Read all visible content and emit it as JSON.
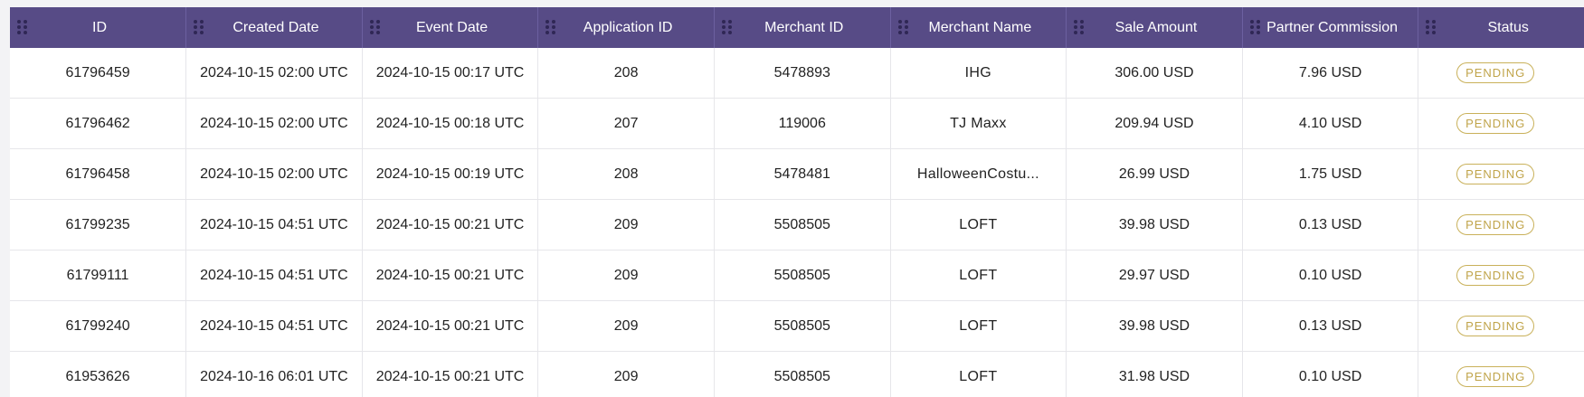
{
  "table": {
    "columns": [
      {
        "key": "id",
        "label": "ID"
      },
      {
        "key": "created_date",
        "label": "Created Date"
      },
      {
        "key": "event_date",
        "label": "Event Date"
      },
      {
        "key": "application_id",
        "label": "Application ID"
      },
      {
        "key": "merchant_id",
        "label": "Merchant ID"
      },
      {
        "key": "merchant_name",
        "label": "Merchant Name"
      },
      {
        "key": "sale_amount",
        "label": "Sale Amount"
      },
      {
        "key": "partner_commission",
        "label": "Partner Commission"
      },
      {
        "key": "status",
        "label": "Status"
      }
    ],
    "rows": [
      {
        "id": "61796459",
        "created_date": "2024-10-15 02:00 UTC",
        "event_date": "2024-10-15 00:17 UTC",
        "application_id": "208",
        "merchant_id": "5478893",
        "merchant_name": "IHG",
        "sale_amount": "306.00 USD",
        "partner_commission": "7.96 USD",
        "status": "PENDING"
      },
      {
        "id": "61796462",
        "created_date": "2024-10-15 02:00 UTC",
        "event_date": "2024-10-15 00:18 UTC",
        "application_id": "207",
        "merchant_id": "119006",
        "merchant_name": "TJ Maxx",
        "sale_amount": "209.94 USD",
        "partner_commission": "4.10 USD",
        "status": "PENDING"
      },
      {
        "id": "61796458",
        "created_date": "2024-10-15 02:00 UTC",
        "event_date": "2024-10-15 00:19 UTC",
        "application_id": "208",
        "merchant_id": "5478481",
        "merchant_name": "HalloweenCostu...",
        "sale_amount": "26.99 USD",
        "partner_commission": "1.75 USD",
        "status": "PENDING"
      },
      {
        "id": "61799235",
        "created_date": "2024-10-15 04:51 UTC",
        "event_date": "2024-10-15 00:21 UTC",
        "application_id": "209",
        "merchant_id": "5508505",
        "merchant_name": "LOFT",
        "sale_amount": "39.98 USD",
        "partner_commission": "0.13 USD",
        "status": "PENDING"
      },
      {
        "id": "61799111",
        "created_date": "2024-10-15 04:51 UTC",
        "event_date": "2024-10-15 00:21 UTC",
        "application_id": "209",
        "merchant_id": "5508505",
        "merchant_name": "LOFT",
        "sale_amount": "29.97 USD",
        "partner_commission": "0.10 USD",
        "status": "PENDING"
      },
      {
        "id": "61799240",
        "created_date": "2024-10-15 04:51 UTC",
        "event_date": "2024-10-15 00:21 UTC",
        "application_id": "209",
        "merchant_id": "5508505",
        "merchant_name": "LOFT",
        "sale_amount": "39.98 USD",
        "partner_commission": "0.13 USD",
        "status": "PENDING"
      },
      {
        "id": "61953626",
        "created_date": "2024-10-16 06:01 UTC",
        "event_date": "2024-10-15 00:21 UTC",
        "application_id": "209",
        "merchant_id": "5508505",
        "merchant_name": "LOFT",
        "sale_amount": "31.98 USD",
        "partner_commission": "0.10 USD",
        "status": "PENDING"
      }
    ]
  },
  "colors": {
    "header_bg": "#574b86",
    "header_text": "#ffffff",
    "grip_dots": "#2f2755",
    "pending_badge": "#c0a44a"
  },
  "icons": {
    "column_drag": "drag-handle-icon"
  }
}
